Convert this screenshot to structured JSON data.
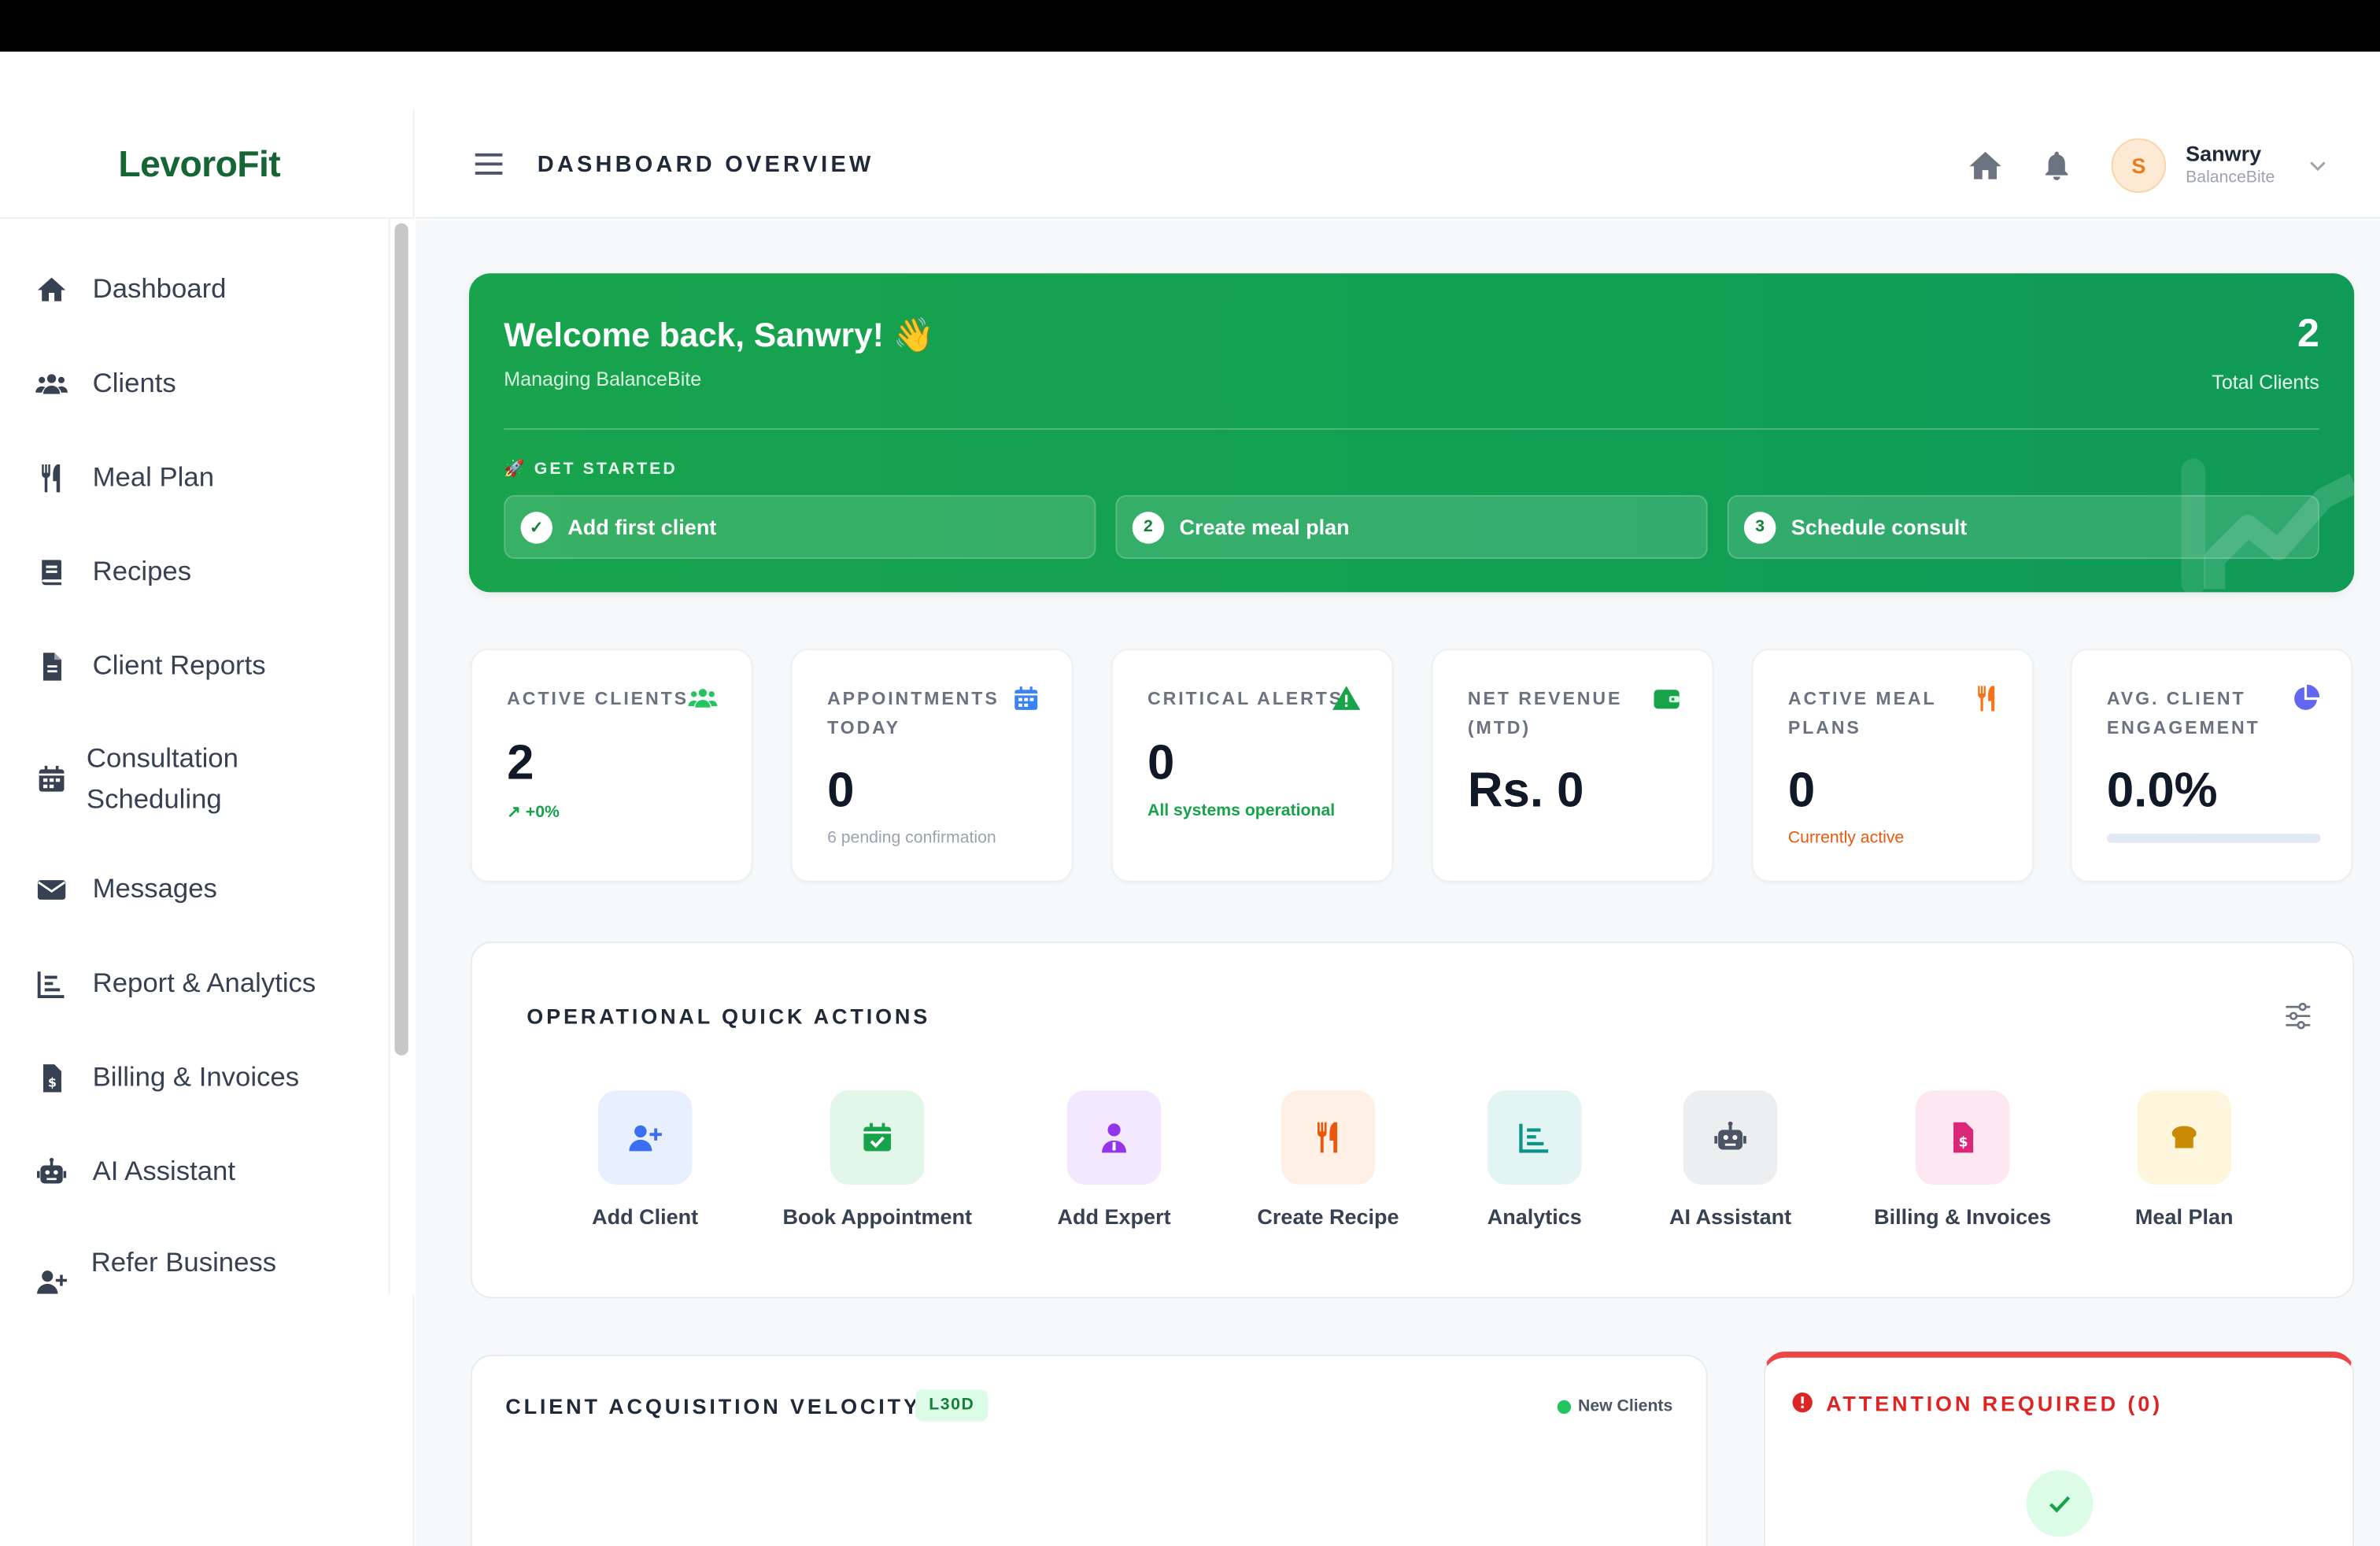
{
  "app": {
    "brand": "LevoroFit"
  },
  "sidebar": {
    "items": [
      {
        "label": "Dashboard",
        "icon": "home-icon"
      },
      {
        "label": "Clients",
        "icon": "users-icon"
      },
      {
        "label": "Meal Plan",
        "icon": "utensils-icon"
      },
      {
        "label": "Recipes",
        "icon": "book-icon"
      },
      {
        "label": "Client Reports",
        "icon": "file-icon"
      },
      {
        "label": "Consultation Scheduling",
        "icon": "calendar-icon"
      },
      {
        "label": "Messages",
        "icon": "envelope-icon"
      },
      {
        "label": "Report & Analytics",
        "icon": "chart-icon"
      },
      {
        "label": "Billing & Invoices",
        "icon": "invoice-icon"
      },
      {
        "label": "AI Assistant",
        "icon": "robot-icon"
      },
      {
        "label": "Refer Business",
        "icon": "user-plus-icon"
      }
    ]
  },
  "header": {
    "title": "DASHBOARD OVERVIEW",
    "user": {
      "initial": "S",
      "name": "Sanwry",
      "org": "BalanceBite"
    }
  },
  "welcome": {
    "title": "Welcome back, Sanwry! 👋",
    "subtitle": "Managing BalanceBite",
    "total_clients": "2",
    "total_clients_label": "Total Clients",
    "get_started": "🚀 GET STARTED",
    "steps": [
      {
        "badge": "✓",
        "label": "Add first client"
      },
      {
        "badge": "2",
        "label": "Create meal plan"
      },
      {
        "badge": "3",
        "label": "Schedule consult"
      }
    ]
  },
  "stats": [
    {
      "label": "ACTIVE CLIENTS",
      "value": "2",
      "note": "↗ +0%",
      "note_color": "#16a34a",
      "icon": "users-icon",
      "icon_color": "#22c55e"
    },
    {
      "label": "APPOINTMENTS TODAY",
      "value": "0",
      "note": "6 pending confirmation",
      "note_color": "#9ca3af",
      "icon": "calendar-icon",
      "icon_color": "#3b82f6"
    },
    {
      "label": "CRITICAL ALERTS",
      "value": "0",
      "note": "All systems operational",
      "note_color": "#16a34a",
      "icon": "warning-icon",
      "icon_color": "#16a34a"
    },
    {
      "label": "NET REVENUE (MTD)",
      "value": "Rs. 0",
      "note": "",
      "note_color": "#9ca3af",
      "icon": "wallet-icon",
      "icon_color": "#16a34a"
    },
    {
      "label": "ACTIVE MEAL PLANS",
      "value": "0",
      "note": "Currently active",
      "note_color": "#ea580c",
      "icon": "utensils-icon",
      "icon_color": "#f97316"
    },
    {
      "label": "AVG. CLIENT ENGAGEMENT",
      "value": "0.0%",
      "note": "",
      "note_color": "#9ca3af",
      "icon": "pie-icon",
      "icon_color": "#6366f1",
      "progress": 0.0
    }
  ],
  "quick_actions": {
    "title": "OPERATIONAL QUICK ACTIONS",
    "items": [
      {
        "label": "Add Client",
        "icon": "user-plus-icon"
      },
      {
        "label": "Book Appointment",
        "icon": "calendar-check-icon"
      },
      {
        "label": "Add Expert",
        "icon": "doctor-icon"
      },
      {
        "label": "Create Recipe",
        "icon": "utensils-icon"
      },
      {
        "label": "Analytics",
        "icon": "chart-icon"
      },
      {
        "label": "AI Assistant",
        "icon": "robot-icon"
      },
      {
        "label": "Billing & Invoices",
        "icon": "invoice-icon"
      },
      {
        "label": "Meal Plan",
        "icon": "bread-icon"
      }
    ]
  },
  "velocity": {
    "title": "CLIENT ACQUISITION VELOCITY",
    "badge": "L30D",
    "legend": "New Clients"
  },
  "attention": {
    "title": "ATTENTION REQUIRED (0)"
  },
  "colors": {
    "brand": "#166534",
    "accent_green": "#16a34a",
    "alert_red": "#dc2626"
  }
}
